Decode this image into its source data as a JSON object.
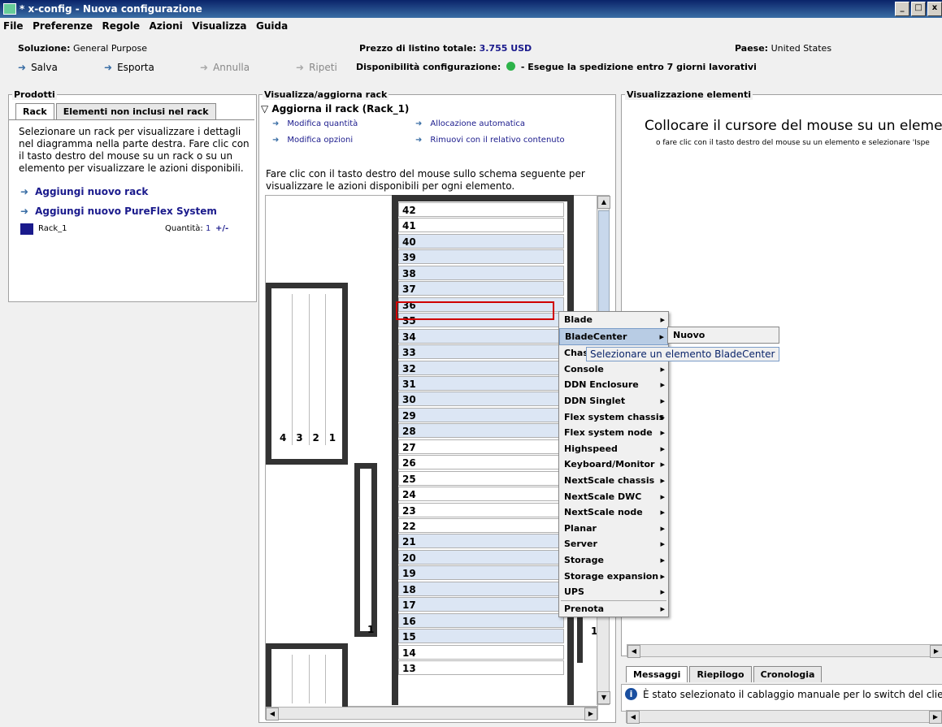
{
  "window": {
    "title": "* x-config - Nuova configurazione",
    "min": "_",
    "max": "□",
    "close": "x"
  },
  "menu": [
    "File",
    "Preferenze",
    "Regole",
    "Azioni",
    "Visualizza",
    "Guida"
  ],
  "info": {
    "solution_label": "Soluzione:",
    "solution_value": "General Purpose",
    "price_label": "Prezzo di listino totale:",
    "price_value": "3.755 USD",
    "country_label": "Paese:",
    "country_value": "United States"
  },
  "toolbar": {
    "save": "Salva",
    "export": "Esporta",
    "undo": "Annulla",
    "redo": "Ripeti",
    "availability_label": "Disponibilità configurazione:",
    "availability_text": "- Esegue la spedizione entro 7 giorni lavorativi"
  },
  "products": {
    "title": "Prodotti",
    "tab_rack": "Rack",
    "tab_non_rack": "Elementi non inclusi nel rack",
    "help": "Selezionare un rack per visualizzare i dettagli nel diagramma nella parte destra. Fare clic con il tasto destro del mouse su un rack o su un elemento per visualizzare le azioni disponibili.",
    "add_rack": "Aggiungi nuovo rack",
    "add_pureflex": "Aggiungi nuovo PureFlex System",
    "rack_name": "Rack_1",
    "qty_label": "Quantità:",
    "qty_value": "1",
    "qty_pm": "+/-"
  },
  "rackview": {
    "title": "Visualizza/aggiorna rack",
    "update_label": "Aggiorna il rack (Rack_1)",
    "act_qty": "Modifica quantità",
    "act_opts": "Modifica opzioni",
    "act_auto": "Allocazione automatica",
    "act_remove": "Rimuovi con il relativo contenuto",
    "help": "Fare clic con il tasto destro del mouse sullo schema seguente per visualizzare le azioni disponibili per ogni elemento.",
    "side_slots": [
      "4",
      "3",
      "2",
      "1"
    ],
    "side_slot_mid": "1",
    "side_slot_right": "1"
  },
  "rack_units": [
    "42",
    "41",
    "40",
    "39",
    "38",
    "37",
    "36",
    "35",
    "34",
    "33",
    "32",
    "31",
    "30",
    "29",
    "28",
    "27",
    "26",
    "25",
    "24",
    "23",
    "22",
    "21",
    "20",
    "19",
    "18",
    "17",
    "16",
    "15",
    "14",
    "13"
  ],
  "context_menu": {
    "items": [
      "Blade",
      "BladeCenter",
      "Chas",
      "Console",
      "DDN Enclosure",
      "DDN Singlet",
      "Flex system chassis",
      "Flex system node",
      "Highspeed",
      "Keyboard/Monitor",
      "NextScale chassis",
      "NextScale DWC",
      "NextScale node",
      "Planar",
      "Server",
      "Storage",
      "Storage expansion",
      "UPS"
    ],
    "last": "Prenota",
    "submenu": "Nuovo bladeCenter...",
    "tooltip": "Selezionare un elemento BladeCenter"
  },
  "elements": {
    "title": "Visualizzazione elementi",
    "heading": "Collocare il cursore del mouse su un elemento p",
    "sub": "o fare clic con il tasto destro del mouse su un elemento e selezionare 'Ispe"
  },
  "bottom": {
    "tabs": [
      "Messaggi",
      "Riepilogo",
      "Cronologia"
    ],
    "message": "È stato selezionato il cablaggio manuale per lo switch del clien"
  },
  "colors": {
    "accent": "#1a1a8c",
    "rack_blue": "#dce6f4",
    "highlight_red": "#d00000"
  }
}
